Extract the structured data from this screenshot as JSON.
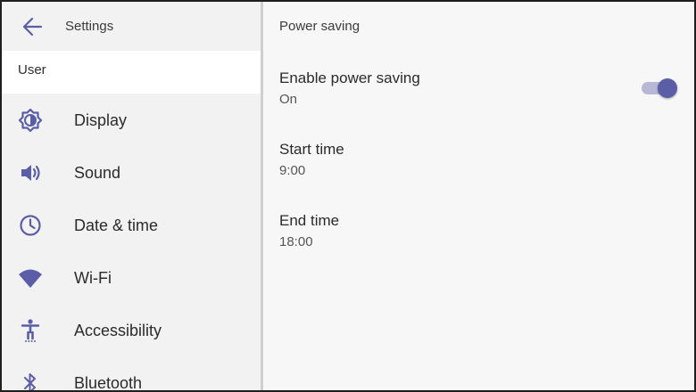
{
  "header": {
    "title": "Settings"
  },
  "sidebar": {
    "section": "User",
    "items": [
      {
        "label": "Display",
        "icon": "display-brightness-icon"
      },
      {
        "label": "Sound",
        "icon": "speaker-icon"
      },
      {
        "label": "Date & time",
        "icon": "clock-icon"
      },
      {
        "label": "Wi-Fi",
        "icon": "wifi-icon"
      },
      {
        "label": "Accessibility",
        "icon": "accessibility-icon"
      },
      {
        "label": "Bluetooth",
        "icon": "bluetooth-icon"
      }
    ]
  },
  "main": {
    "title": "Power saving",
    "settings": [
      {
        "title": "Enable power saving",
        "value": "On",
        "toggle_on": true
      },
      {
        "title": "Start time",
        "value": "9:00"
      },
      {
        "title": "End time",
        "value": "18:00"
      }
    ]
  },
  "colors": {
    "accent": "#5b5ea6",
    "accent_light": "#b8b8d6",
    "text": "#2b2b2b"
  }
}
